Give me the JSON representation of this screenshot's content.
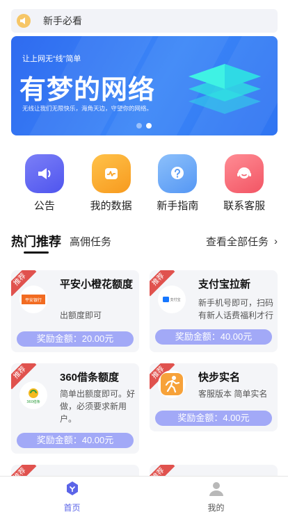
{
  "notice": {
    "text": "新手必看"
  },
  "banner": {
    "subtitle": "让上网无“线”简单",
    "title": "有梦的网络",
    "description": "无线让我们无限快乐，海角天边，守望你的网络。"
  },
  "actions": [
    {
      "label": "公告",
      "icon": "megaphone-icon",
      "color": "#5d63f1"
    },
    {
      "label": "我的数据",
      "icon": "data-chart-icon",
      "color": "#fba72f"
    },
    {
      "label": "新手指南",
      "icon": "help-icon",
      "color": "#60a2f7"
    },
    {
      "label": "联系客服",
      "icon": "customer-service-icon",
      "color": "#f86a75"
    }
  ],
  "tabs": {
    "hot": "热门推荐",
    "high": "高佣任务",
    "view_all": "查看全部任务"
  },
  "cards": [
    {
      "ribbon": "推荐",
      "title": "平安小橙花额度",
      "desc": "出额度即可",
      "reward": "奖励金额：20.00元"
    },
    {
      "ribbon": "推荐",
      "title": "支付宝拉新",
      "desc": "新手机号即可，扫码有新人话费福利才行",
      "reward": "奖励金额：40.00元"
    },
    {
      "ribbon": "推荐",
      "title": "360借条额度",
      "desc": "简单出额度即可。好做，必须要求新用户。",
      "reward": "奖励金额：40.00元"
    },
    {
      "ribbon": "推荐",
      "title": "快步实名",
      "desc": "客服版本 简单实名",
      "reward": "奖励金额：4.00元"
    },
    {
      "ribbon": "推荐",
      "title": "",
      "desc": "",
      "reward": ""
    },
    {
      "ribbon": "推荐",
      "title": "",
      "desc": "",
      "reward": ""
    }
  ],
  "nav": {
    "home": "首页",
    "mine": "我的"
  },
  "colors": {
    "accent": "#5b64e8",
    "reward": "#a2a9f7",
    "ribbon": "#e0524e",
    "banner": "#3b86f7"
  }
}
